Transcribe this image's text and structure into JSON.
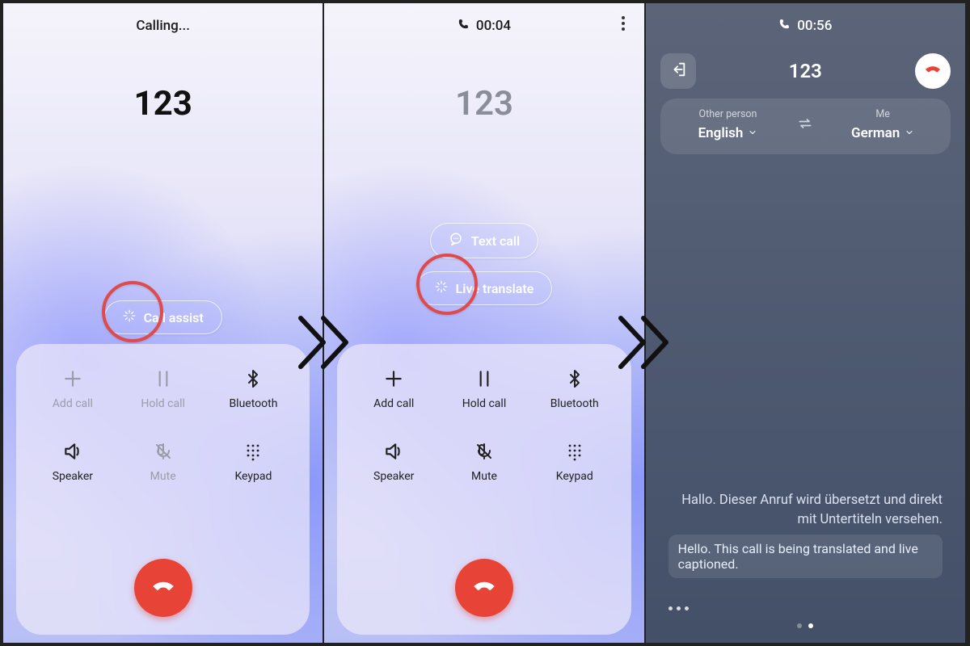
{
  "panel1": {
    "status": "Calling...",
    "number": "123",
    "call_assist_label": "Call assist",
    "controls": {
      "add_call": "Add call",
      "hold_call": "Hold call",
      "bluetooth": "Bluetooth",
      "speaker": "Speaker",
      "mute": "Mute",
      "keypad": "Keypad"
    }
  },
  "panel2": {
    "timer": "00:04",
    "number": "123",
    "text_call_label": "Text call",
    "live_translate_label": "Live translate",
    "controls": {
      "add_call": "Add call",
      "hold_call": "Hold call",
      "bluetooth": "Bluetooth",
      "speaker": "Speaker",
      "mute": "Mute",
      "keypad": "Keypad"
    }
  },
  "panel3": {
    "timer": "00:56",
    "number": "123",
    "other_label": "Other person",
    "other_lang": "English",
    "me_label": "Me",
    "me_lang": "German",
    "caption_src": "Hallo. Dieser Anruf wird übersetzt und direkt mit Untertiteln versehen.",
    "caption_trans": "Hello. This call is being translated and live captioned."
  }
}
